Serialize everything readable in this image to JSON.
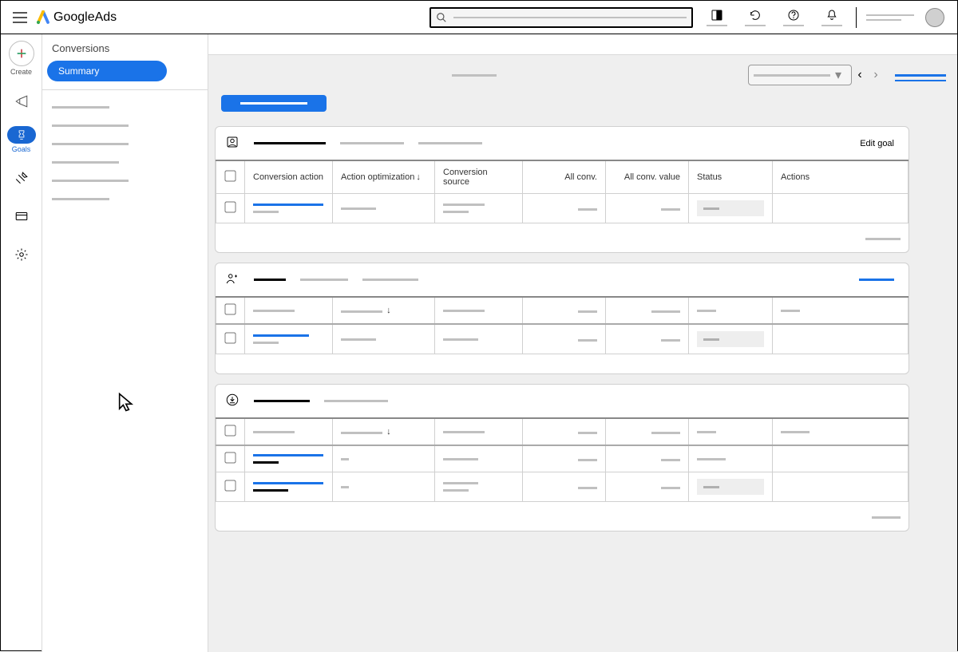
{
  "topbar": {
    "product_name_a": "Google ",
    "product_name_b": "Ads"
  },
  "rail": {
    "create": "Create",
    "goals": "Goals"
  },
  "sidepanel": {
    "breadcrumb": "Conversions",
    "active": "Summary"
  },
  "card_link": {
    "edit_goal": "Edit goal"
  },
  "headers": {
    "conversion_action": "Conversion action",
    "action_optimization": "Action optimization",
    "conversion_source": "Conversion source",
    "all_conv": "All conv.",
    "all_conv_value": "All conv. value",
    "status": "Status",
    "actions": "Actions"
  }
}
